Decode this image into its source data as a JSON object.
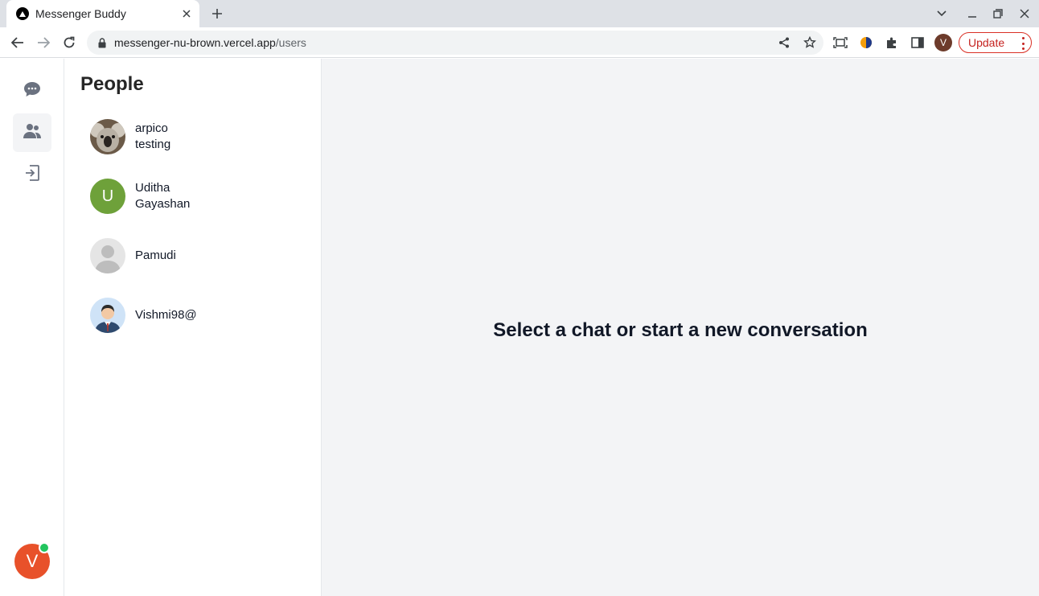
{
  "browser": {
    "tab_title": "Messenger Buddy",
    "url_host": "messenger-nu-brown.vercel.app",
    "url_path": "/users",
    "profile_initial": "V",
    "update_label": "Update"
  },
  "app": {
    "people_title": "People",
    "people": [
      {
        "name": "arpico testing",
        "avatar": "koala-photo"
      },
      {
        "name": "Uditha Gayashan",
        "avatar": "initial",
        "initial": "U",
        "color": "#6ea13a"
      },
      {
        "name": "Pamudi",
        "avatar": "placeholder"
      },
      {
        "name": "Vishmi98@",
        "avatar": "businessman-illustration"
      }
    ],
    "empty_state": "Select a chat or start a new conversation",
    "current_user_initial": "V",
    "colors": {
      "accent_avatar": "#e8512a",
      "online": "#22c55e",
      "main_bg": "#f3f4f6"
    }
  }
}
